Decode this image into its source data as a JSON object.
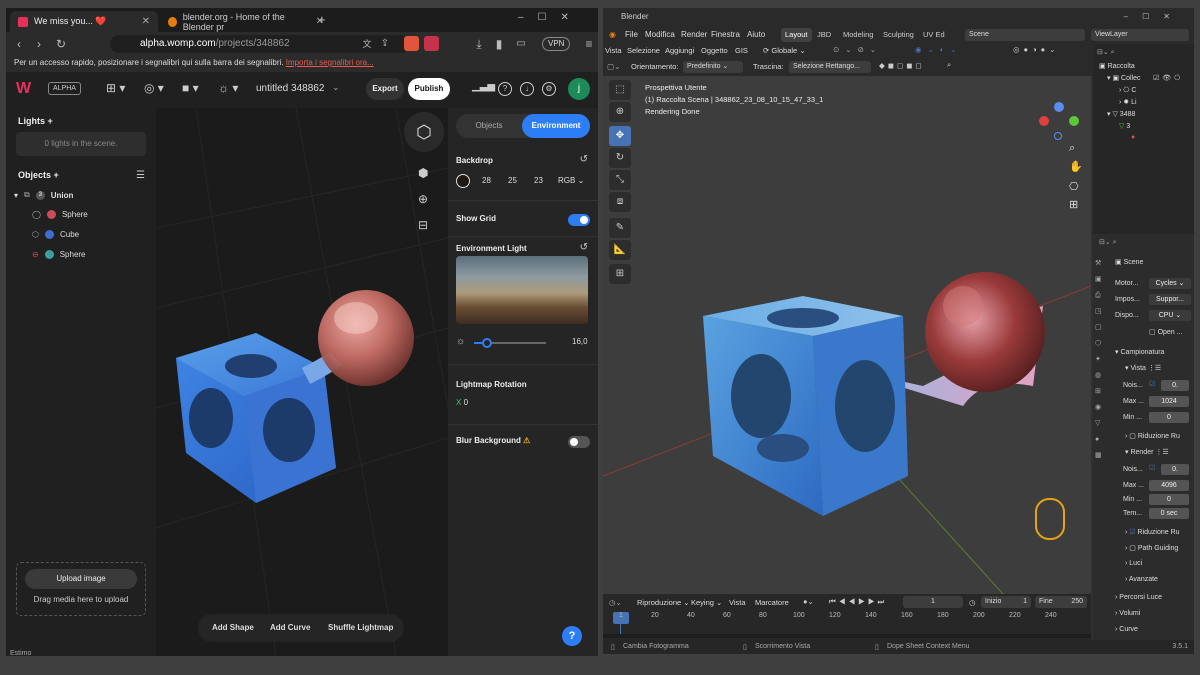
{
  "browser": {
    "tabs": [
      {
        "title": "We miss you... ❤️",
        "active": true
      },
      {
        "title": "blender.org - Home of the Blender pr",
        "active": false
      }
    ],
    "new_tab": "+",
    "url_host": "alpha.womp.com",
    "url_path": "/projects/348862",
    "vpn": "VPN",
    "bookmarks_text": "Per un accesso rapido, posizionare i segnalibri qui sulla barra dei segnalibri.",
    "bookmarks_link": "Importa i segnalibri ora..."
  },
  "womp": {
    "logo": "W",
    "badge": "ALPHA",
    "project_title": "untitled 348862",
    "export": "Export",
    "publish": "Publish",
    "avatar": "j",
    "lights_label": "Lights",
    "no_lights": "0 lights in the scene.",
    "objects_label": "Objects",
    "union_count": "3",
    "union_label": "Union",
    "objects": [
      {
        "name": "Sphere",
        "color": "#d04a5b"
      },
      {
        "name": "Cube",
        "color": "#3a6fd0"
      },
      {
        "name": "Sphere",
        "color": "#3aa0a0"
      }
    ],
    "upload_button": "Upload image",
    "upload_hint": "Drag media here to upload",
    "tab_objects": "Objects",
    "tab_environment": "Environment",
    "backdrop_label": "Backdrop",
    "backdrop_r": "28",
    "backdrop_g": "25",
    "backdrop_b": "23",
    "backdrop_mode": "RGB",
    "show_grid_label": "Show Grid",
    "show_grid_on": true,
    "env_light_label": "Environment Light",
    "env_intensity": "16,0",
    "lightmap_label": "Lightmap Rotation",
    "lightmap_axis": "X",
    "lightmap_value": "0",
    "blur_label": "Blur Background",
    "blur_warning": "⚠",
    "blur_on": false,
    "add_shape": "Add Shape",
    "add_curve": "Add Curve",
    "shuffle": "Shuffle Lightmap",
    "help": "?"
  },
  "blender": {
    "title": "Blender",
    "menu": [
      "File",
      "Modifica",
      "Render",
      "Finestra",
      "Aiuto"
    ],
    "workspaces": [
      {
        "label": "Layout",
        "active": true
      },
      {
        "label": "JBD",
        "active": false
      },
      {
        "label": "Modeling",
        "active": false
      },
      {
        "label": "Sculpting",
        "active": false
      },
      {
        "label": "UV Ed",
        "active": false
      }
    ],
    "scene": "Scene",
    "viewlayer": "ViewLayer",
    "header2": [
      "Vista",
      "Selezione",
      "Aggiungi",
      "Oggetto",
      "GIS"
    ],
    "global": "Globale",
    "orient_label": "Orientamento:",
    "orient_value": "Predefinito",
    "drag_label": "Trascina:",
    "drag_value": "Selezione Rettango...",
    "info_line1": "Prospettiva Utente",
    "info_line2": "(1) Raccolta Scena | 348862_23_08_10_15_47_33_1",
    "info_line3": "Rendering Done",
    "outliner": [
      {
        "label": "Raccolta"
      },
      {
        "label": "Collec"
      },
      {
        "label": "C"
      },
      {
        "label": "Li"
      },
      {
        "label": "3488"
      },
      {
        "label": "3"
      }
    ],
    "props_scene": "Scene",
    "engine_label": "Motor...",
    "engine_value": "Cycles",
    "feature_label": "Impos...",
    "feature_value": "Suppor...",
    "device_label": "Dispo...",
    "device_value": "CPU",
    "open_label": "Open ...",
    "sampling": "Campionatura",
    "viewport": "Vista",
    "noise1_label": "Nois...",
    "noise1_value": "0.",
    "max1_label": "Max ...",
    "max1_value": "1024",
    "min1_label": "Min ...",
    "min1_value": "0",
    "denoise1": "Riduzione Ru",
    "render": "Render",
    "noise2_label": "Nois...",
    "noise2_value": "0.",
    "max2_label": "Max ...",
    "max2_value": "4096",
    "min2_label": "Min ...",
    "min2_value": "0",
    "time_label": "Tem...",
    "time_value": "0 sec",
    "denoise2": "Riduzione Ru",
    "path_guiding": "Path Guiding",
    "lights": "Luci",
    "advanced": "Avanzate",
    "light_paths": "Percorsi Luce",
    "volumes": "Volumi",
    "curves": "Curve",
    "timeline_menu": [
      "Riproduzione",
      "Keying",
      "Vista",
      "Marcatore"
    ],
    "current_frame": "1",
    "start_label": "Inizio",
    "start_value": "1",
    "end_label": "Fine",
    "end_value": "250",
    "ticks": [
      "1",
      "20",
      "40",
      "60",
      "80",
      "100",
      "120",
      "140",
      "160",
      "180",
      "200",
      "220",
      "240"
    ],
    "status_1": "Cambia Fotogramma",
    "status_2": "Scorrimento Vista",
    "status_3": "Dope Sheet Context Menu",
    "version": "3.5.1"
  },
  "below_text": "Estimo"
}
